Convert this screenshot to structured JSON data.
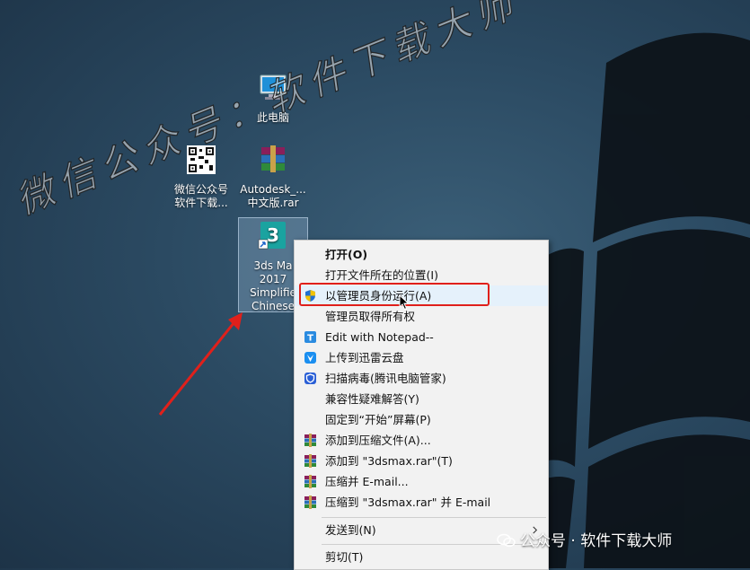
{
  "desktop": {
    "icons": [
      {
        "label": "此电脑"
      },
      {
        "label_line1": "微信公众号",
        "label_line2": "软件下载..."
      },
      {
        "label_line1": "Autodesk_...",
        "label_line2": "中文版.rar"
      },
      {
        "label_lines": [
          "3ds Ma",
          "2017",
          "Simplifie",
          "Chinese"
        ]
      }
    ],
    "watermark": "微信公众号：软件下载大师"
  },
  "context_menu": {
    "items": [
      {
        "label": "打开(O)",
        "icon": "none"
      },
      {
        "label": "打开文件所在的位置(I)",
        "icon": "none"
      },
      {
        "label": "以管理员身份运行(A)",
        "icon": "uac-shield-icon"
      },
      {
        "label": "管理员取得所有权",
        "icon": "none"
      },
      {
        "label": "Edit with Notepad--",
        "icon": "notepad-icon"
      },
      {
        "label": "上传到迅雷云盘",
        "icon": "thunder-cloud-icon"
      },
      {
        "label": "扫描病毒(腾讯电脑管家)",
        "icon": "tencent-shield-icon"
      },
      {
        "label": "兼容性疑难解答(Y)",
        "icon": "none"
      },
      {
        "label": "固定到“开始”屏幕(P)",
        "icon": "none"
      },
      {
        "label": "添加到压缩文件(A)...",
        "icon": "winrar-icon"
      },
      {
        "label": "添加到 \"3dsmax.rar\"(T)",
        "icon": "winrar-icon"
      },
      {
        "label": "压缩并 E-mail...",
        "icon": "winrar-icon"
      },
      {
        "label": "压缩到 \"3dsmax.rar\" 并 E-mail",
        "icon": "winrar-icon"
      },
      {
        "label": "发送到(N)",
        "icon": "none"
      },
      {
        "label": "剪切(T)",
        "icon": "none"
      }
    ]
  },
  "footer_brand": "公众号 · 软件下载大师",
  "colors": {
    "highlight": "#e5f1fb",
    "annotation_red": "#e0201b"
  }
}
